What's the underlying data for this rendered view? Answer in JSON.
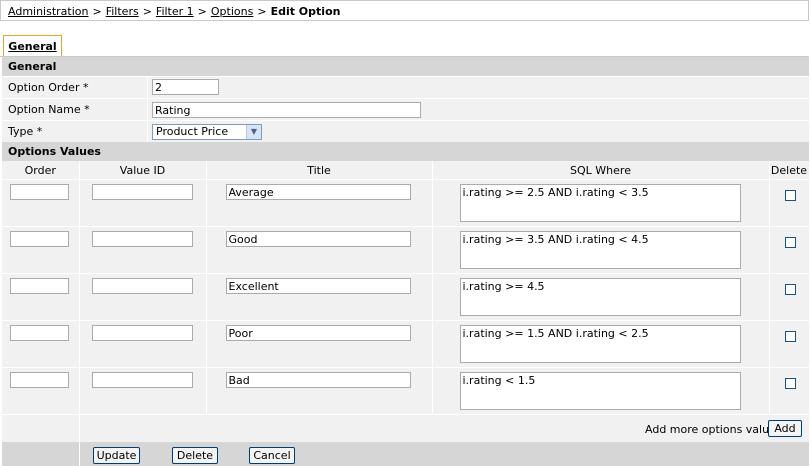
{
  "breadcrumb": {
    "items": [
      "Administration",
      "Filters",
      "Filter 1",
      "Options"
    ],
    "separator": ">",
    "current": "Edit Option"
  },
  "tab": {
    "label": "General"
  },
  "general": {
    "header": "General",
    "option_order_label": "Option Order *",
    "option_order_value": "2",
    "option_name_label": "Option Name *",
    "option_name_value": "Rating",
    "type_label": "Type *",
    "type_value": "Product Price"
  },
  "options": {
    "header": "Options Values",
    "columns": {
      "order": "Order",
      "value_id": "Value ID",
      "title": "Title",
      "sql_where": "SQL Where",
      "delete": "Delete"
    },
    "rows": [
      {
        "order": "",
        "value_id": "",
        "title": "Average",
        "sql": "i.rating >= 2.5 AND i.rating < 3.5",
        "delete": false
      },
      {
        "order": "",
        "value_id": "",
        "title": "Good",
        "sql": "i.rating >= 3.5 AND i.rating < 4.5",
        "delete": false
      },
      {
        "order": "",
        "value_id": "",
        "title": "Excellent",
        "sql": "i.rating >= 4.5",
        "delete": false
      },
      {
        "order": "",
        "value_id": "",
        "title": "Poor",
        "sql": "i.rating >= 1.5 AND i.rating < 2.5",
        "delete": false
      },
      {
        "order": "",
        "value_id": "",
        "title": "Bad",
        "sql": "i.rating < 1.5",
        "delete": false
      }
    ],
    "add_more_label": "Add more options values?",
    "add_button": "Add"
  },
  "buttons": {
    "update": "Update",
    "delete": "Delete",
    "cancel": "Cancel"
  }
}
